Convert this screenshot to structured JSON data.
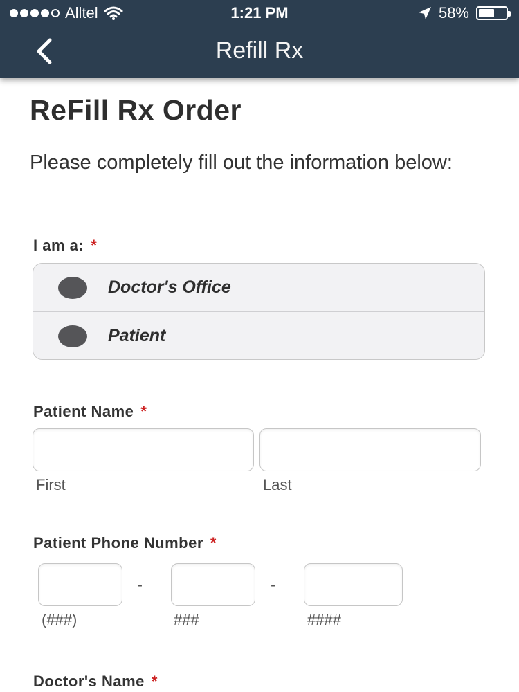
{
  "status_bar": {
    "carrier": "Alltel",
    "time": "1:21 PM",
    "battery": "58%",
    "signal_icon": "signal-dots-icon",
    "wifi_icon": "wifi-icon",
    "location_icon": "location-arrow-icon",
    "battery_icon": "battery-icon",
    "battery_level": 0.58
  },
  "nav": {
    "title": "Refill Rx",
    "back_icon": "back-chevron-icon"
  },
  "page": {
    "title": "ReFill Rx Order",
    "intro": "Please completely fill out the information below:"
  },
  "form": {
    "required_mark": "*",
    "iam": {
      "label": "I am a:",
      "options": [
        "Doctor's Office",
        "Patient"
      ]
    },
    "patient_name": {
      "label": "Patient Name",
      "first_hint": "First",
      "last_hint": "Last",
      "first_value": "",
      "last_value": ""
    },
    "patient_phone": {
      "label": "Patient Phone Number",
      "separator": "-",
      "area_hint": "(###)",
      "prefix_hint": "###",
      "line_hint": "####",
      "area_value": "",
      "prefix_value": "",
      "line_value": ""
    },
    "doctor_name": {
      "label": "Doctor's Name"
    }
  },
  "colors": {
    "header_bg": "#2c3e50",
    "required": "#cc1f1f",
    "radio_dot": "#555558"
  }
}
